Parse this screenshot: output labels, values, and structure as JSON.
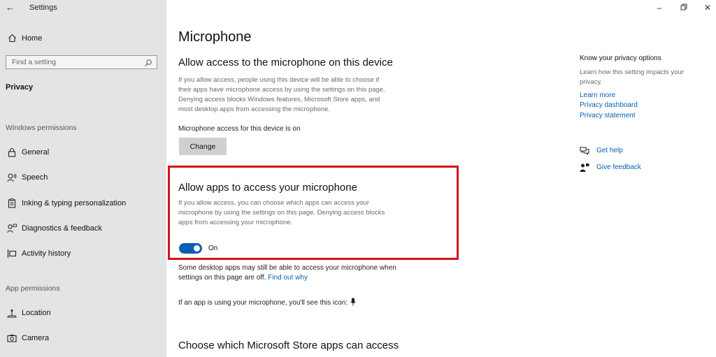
{
  "window": {
    "title": "Settings"
  },
  "sidebar": {
    "home_label": "Home",
    "search_placeholder": "Find a setting",
    "current_section": "Privacy",
    "group1_header": "Windows permissions",
    "group1_items": [
      "General",
      "Speech",
      "Inking & typing personalization",
      "Diagnostics & feedback",
      "Activity history"
    ],
    "group2_header": "App permissions",
    "group2_items": [
      "Location",
      "Camera"
    ]
  },
  "main": {
    "page_title": "Microphone",
    "device_section": {
      "heading": "Allow access to the microphone on this device",
      "desc_lines": [
        "If you allow access, people using this device will be able to choose if",
        "their apps have microphone access by using the settings on this page.",
        "Denying access blocks Windows features, Microsoft Store apps, and",
        "most desktop apps from accessing the microphone."
      ],
      "status": "Microphone access for this device is on",
      "button_label": "Change"
    },
    "apps_section": {
      "heading": "Allow apps to access your microphone",
      "desc_lines": [
        "If you allow access, you can choose which apps can access your",
        "microphone by using the settings on this page. Denying access blocks",
        "apps from accessing your microphone."
      ],
      "toggle_state": "On",
      "toggle_on": true
    },
    "desktop_note_line1": "Some desktop apps may still be able to access your microphone when",
    "desktop_note_line2": "settings on this page are off.",
    "desktop_note_link": "Find out why",
    "icon_note": "If an app is using your microphone, you'll see this icon:",
    "store_heading": "Choose which Microsoft Store apps can access"
  },
  "right_panel": {
    "title": "Know your privacy options",
    "desc_lines": [
      "Learn how this setting impacts your",
      "privacy."
    ],
    "links": [
      "Learn more",
      "Privacy dashboard",
      "Privacy statement"
    ],
    "help_label": "Get help",
    "feedback_label": "Give feedback"
  },
  "colors": {
    "accent": "#0a5fb4",
    "highlight_border": "#d3121b",
    "sidebar_bg": "#e4e4e4"
  }
}
